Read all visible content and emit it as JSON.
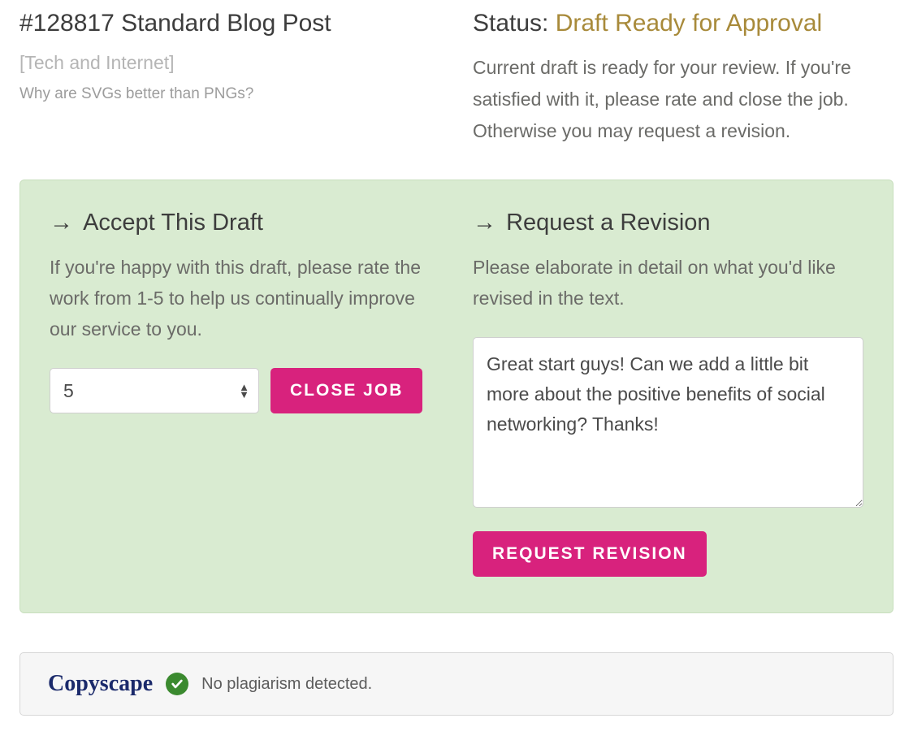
{
  "header": {
    "title": "#128817 Standard Blog Post",
    "category": "[Tech and Internet]",
    "topic": "Why are SVGs better than PNGs?",
    "status_label": "Status: ",
    "status_value": "Draft Ready for Approval",
    "status_description": "Current draft is ready for your review. If you're satisfied with it, please rate and close the job. Otherwise you may request a revision."
  },
  "accept": {
    "heading": "Accept This Draft",
    "description": "If you're happy with this draft, please rate the work from 1-5 to help us continually improve our service to you.",
    "rating_value": "5",
    "button_label": "CLOSE JOB"
  },
  "revision": {
    "heading": "Request a Revision",
    "description": "Please elaborate in detail on what you'd like revised in the text.",
    "textarea_value": "Great start guys! Can we add a little bit more about the positive benefits of social networking? Thanks!",
    "button_label": "REQUEST REVISION"
  },
  "copyscape": {
    "logo_text": "Copyscape",
    "status_text": "No plagiarism detected."
  }
}
